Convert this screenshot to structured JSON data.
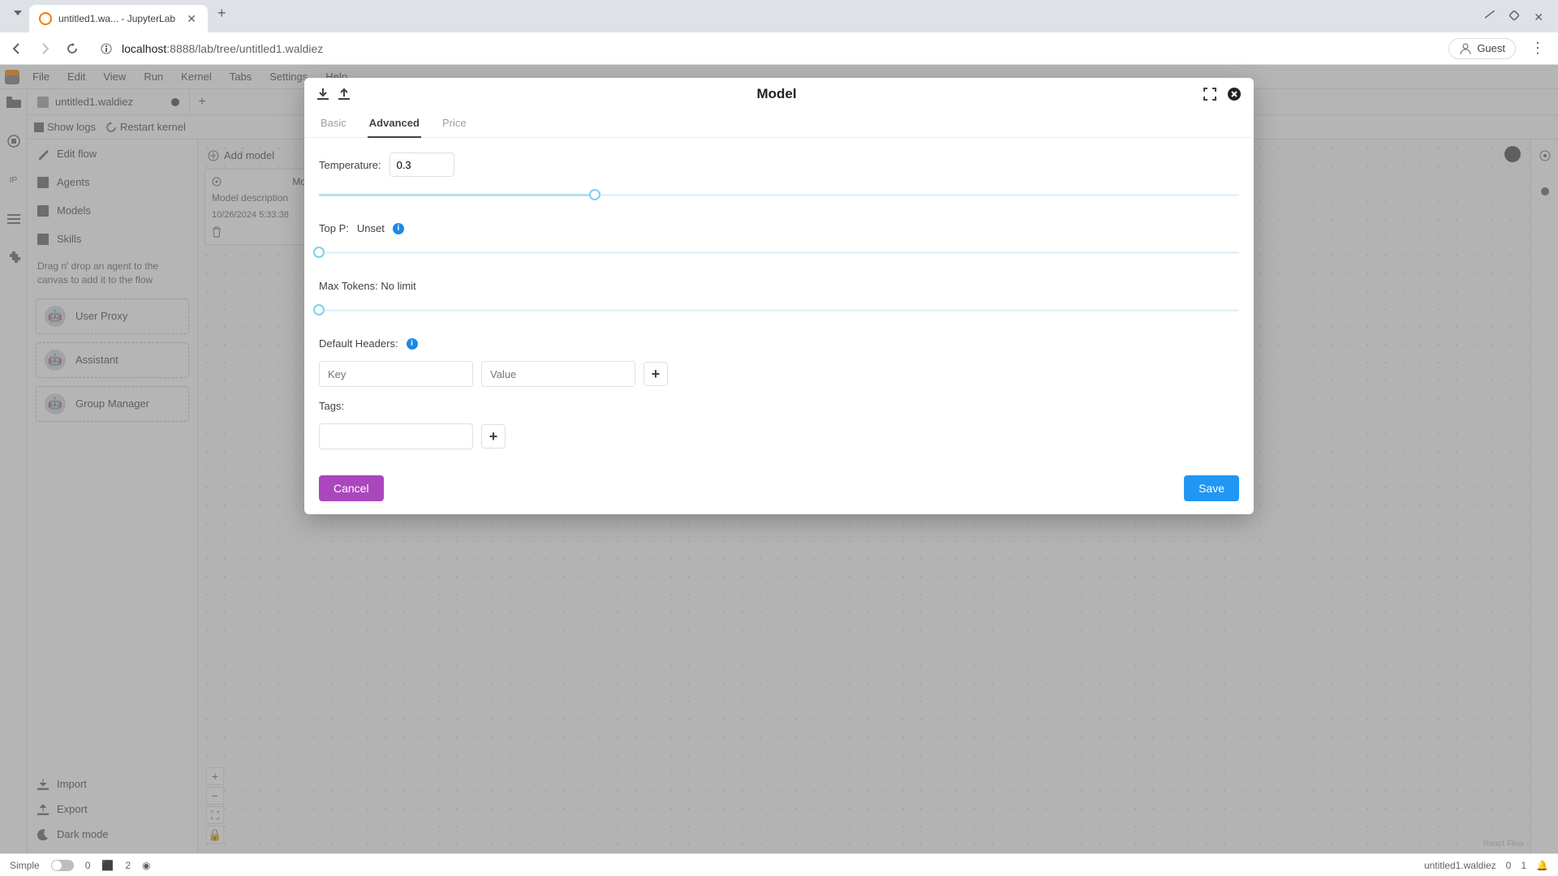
{
  "browser": {
    "tab_title": "untitled1.wa... - JupyterLab",
    "url_host": "localhost",
    "url_port_path": ":8888/lab/tree/untitled1.waldiez",
    "guest_label": "Guest"
  },
  "menu": {
    "items": [
      "File",
      "Edit",
      "View",
      "Run",
      "Kernel",
      "Tabs",
      "Settings",
      "Help"
    ]
  },
  "doc_tab": {
    "title": "untitled1.waldiez"
  },
  "doc_toolbar": {
    "show_logs": "Show logs",
    "restart_kernel": "Restart kernel"
  },
  "side": {
    "edit_flow": "Edit flow",
    "agents": "Agents",
    "models": "Models",
    "skills": "Skills",
    "hint": "Drag n' drop an agent to the canvas to add it to the flow",
    "drag_items": [
      "User Proxy",
      "Assistant",
      "Group Manager"
    ],
    "import": "Import",
    "export": "Export",
    "dark_mode": "Dark mode"
  },
  "canvas": {
    "add_model": "Add model",
    "card_title": "Model",
    "card_desc": "Model description",
    "card_date": "10/26/2024 5:33:38",
    "attribution": "React Flow"
  },
  "modal": {
    "title": "Model",
    "tabs": {
      "basic": "Basic",
      "advanced": "Advanced",
      "price": "Price"
    },
    "temperature_label": "Temperature:",
    "temperature_value": "0.3",
    "temperature_pct": 30,
    "top_p_label": "Top P:",
    "top_p_value": "Unset",
    "top_p_pct": 0,
    "max_tokens_label": "Max Tokens: No limit",
    "max_tokens_pct": 0,
    "headers_label": "Default Headers:",
    "headers_key_ph": "Key",
    "headers_val_ph": "Value",
    "tags_label": "Tags:",
    "cancel": "Cancel",
    "save": "Save"
  },
  "status": {
    "simple": "Simple",
    "count0": "0",
    "count2": "2",
    "filename": "untitled1.waldiez",
    "zero": "0",
    "one": "1"
  }
}
